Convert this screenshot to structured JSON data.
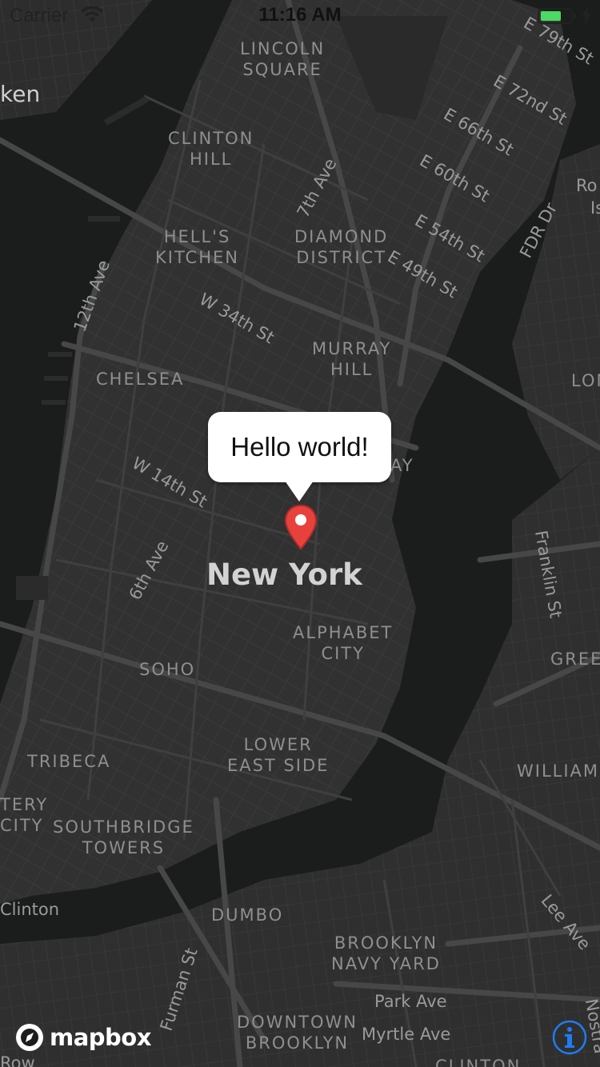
{
  "status_bar": {
    "carrier": "Carrier",
    "time": "11:16 AM",
    "battery_level": 0.7,
    "battery_color": "#4cd964"
  },
  "callout": {
    "text": "Hello world!"
  },
  "marker": {
    "icon": "map-pin-icon",
    "color": "#e8413c"
  },
  "attribution": {
    "logo_text": "mapbox",
    "info_icon": "info-icon",
    "info_color": "#1e7cf2"
  },
  "map": {
    "style": "dark",
    "background_color": "#1b1c1c",
    "land_color": "#313131",
    "road_color": "#454545",
    "city_label": "New York",
    "neighborhoods": {
      "lincoln_square": [
        "LINCOLN",
        "SQUARE"
      ],
      "clinton_hill": [
        "CLINTON",
        "HILL"
      ],
      "hells_kitchen": [
        "HELL'S",
        "KITCHEN"
      ],
      "diamond_district": [
        "DIAMOND",
        "DISTRICT"
      ],
      "murray_hill": [
        "MURRAY",
        "HILL"
      ],
      "chelsea": "CHELSEA",
      "alphabet_city": [
        "ALPHABET",
        "CITY"
      ],
      "soho": "SOHO",
      "lower_east_side": [
        "LOWER",
        "EAST SIDE"
      ],
      "tribeca": "TRIBECA",
      "battery_city": [
        "TERY",
        "CITY"
      ],
      "southbridge_towers": [
        "SOUTHBRIDGE",
        "TOWERS"
      ],
      "dumbo": "DUMBO",
      "brooklyn_navy_yard": [
        "BROOKLYN",
        "NAVY YARD"
      ],
      "downtown_brooklyn": [
        "DOWNTOWN",
        "BROOKLYN"
      ],
      "greenpoint": "GREE",
      "williamsburg": "WILLIAMS",
      "long_island": "LON",
      "roosevelt_island": [
        "Ro",
        "Is"
      ],
      "hoboken": "ken",
      "clinton_hill_bk": "CLINTON",
      "flatiron_fragment": "AY"
    },
    "streets": {
      "e79": "E 79th St",
      "e72": "E 72nd St",
      "e66": "E 66th St",
      "e60": "E 60th St",
      "e54": "E 54th St",
      "e49": "E 49th St",
      "seventh_ave": "7th Ave",
      "fdr": "FDR Dr",
      "twelfth_ave": "12th Ave",
      "w34": "W 34th St",
      "w14": "W 14th St",
      "sixth_ave": "6th Ave",
      "franklin": "Franklin St",
      "lee_ave": "Lee Ave",
      "furman": "Furman St",
      "park_ave": "Park Ave",
      "myrtle_ave": "Myrtle Ave",
      "nostrand": "Nostra",
      "clinton_st": "Clinton",
      "row": "Row"
    }
  }
}
